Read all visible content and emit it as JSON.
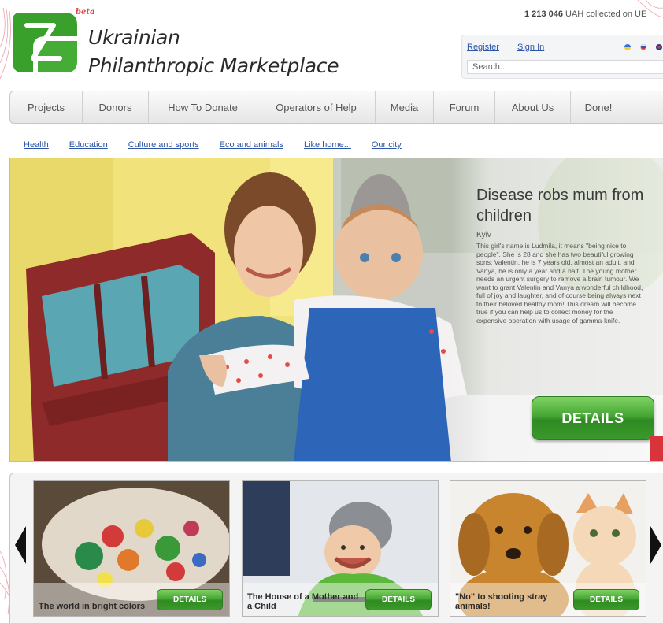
{
  "header": {
    "beta_label": "beta",
    "site_title_line1": "Ukrainian",
    "site_title_line2": "Philanthropic Marketplace",
    "collected_amount": "1 213 046",
    "collected_suffix": "UAH collected on UE"
  },
  "auth": {
    "register_label": "Register",
    "signin_label": "Sign In",
    "search_placeholder": "Search...",
    "language_flags": [
      "ukraine-flag-icon",
      "russia-flag-icon",
      "uk-flag-icon"
    ]
  },
  "nav": {
    "items": [
      {
        "label": "Projects"
      },
      {
        "label": "Donors"
      },
      {
        "label": "How To Donate"
      },
      {
        "label": "Operators of Help"
      },
      {
        "label": "Media"
      },
      {
        "label": "Forum"
      },
      {
        "label": "About Us"
      },
      {
        "label": "Done!"
      }
    ]
  },
  "categories": [
    {
      "label": "Health"
    },
    {
      "label": "Education"
    },
    {
      "label": "Culture and sports"
    },
    {
      "label": "Eco and animals"
    },
    {
      "label": "Like home..."
    },
    {
      "label": "Our city"
    }
  ],
  "hero": {
    "title": "Disease robs mum from children",
    "city": "Kyiv",
    "description": "This girl's name is Ludmila, it means \"being nice to people\". She is 28 and she has two beautiful growing sons: Valentin, he is 7 years old, almost an adult, and Vanya, he is only a year and a half. The young mother needs an urgent surgery to remove a brain tumour. We want to grant Valentin and Vanya a wonderful childhood, full of joy and laughter, and of course being always next to their beloved healthy mom! This dream will become true if you can help us to collect money for the expensive operation with usage of gamma-knife.",
    "details_label": "DETAILS"
  },
  "cards": [
    {
      "title": "The world in bright colors",
      "details_label": "DETAILS"
    },
    {
      "title": "The House of a Mother and a Child",
      "details_label": "DETAILS"
    },
    {
      "title": "\"No\" to shooting stray animals!",
      "details_label": "DETAILS"
    }
  ],
  "colors": {
    "brand_green": "#3aa02c",
    "link_blue": "#2c55a8",
    "beta_red": "#e04545"
  }
}
